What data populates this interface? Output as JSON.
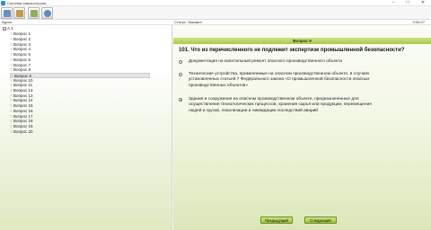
{
  "window": {
    "title": "Система самоконтроля",
    "minimize": "–",
    "maximize": "□",
    "close": "✕"
  },
  "toolbar": {
    "buttons": [
      {
        "icon": "exit-icon",
        "color": "#6d8fc0"
      },
      {
        "icon": "checklist-icon",
        "color": "#c39a4f"
      },
      {
        "icon": "document-icon",
        "color": "#8eaf5c"
      },
      {
        "icon": "globe-icon",
        "color": "#5f8fb8"
      }
    ]
  },
  "header": {
    "left_label": "Курсы",
    "status_label": "Статус: Экзамен",
    "timer": "0:05:27"
  },
  "tree": {
    "expander": "–",
    "root_label": "A.1",
    "items": [
      "Вопрос 1",
      "Вопрос 2",
      "Вопрос 3",
      "Вопрос 4",
      "Вопрос 5",
      "Вопрос 6",
      "Вопрос 7",
      "Вопрос 8",
      "Вопрос 9",
      "Вопрос 10",
      "Вопрос 11",
      "Вопрос 12",
      "Вопрос 13",
      "Вопрос 14",
      "Вопрос 15",
      "Вопрос 16",
      "Вопрос 17",
      "Вопрос 18",
      "Вопрос 19",
      "Вопрос 20"
    ],
    "selected_index": 8,
    "item_glyph": "?"
  },
  "question": {
    "header": "Вопрос 9",
    "text": "101. Что из перечисленного не подлежит экспертизе промышленной безопасности?",
    "answers": [
      {
        "lines": [
          "Документация на капитальный ремонт опасного производственного объекта"
        ],
        "selected": false
      },
      {
        "lines": [
          "Технические устройства, применяемые на опасном производственном объекте, в случаях",
          "установленных статьей 7 Федерального закона «О промышленной безопасности опасных",
          "производственных объектов»"
        ],
        "selected": false
      },
      {
        "lines": [
          "Здания и сооружения на опасном производственном объекте, предназначенные для",
          "осуществления технологических процессов, хранения сырья или продукции, перемещения",
          "людей и грузов, локализации и ликвидации последствий аварий"
        ],
        "selected": true
      }
    ]
  },
  "navigation": {
    "prev_label": "Предыдущий",
    "next_label": "Следующий"
  }
}
